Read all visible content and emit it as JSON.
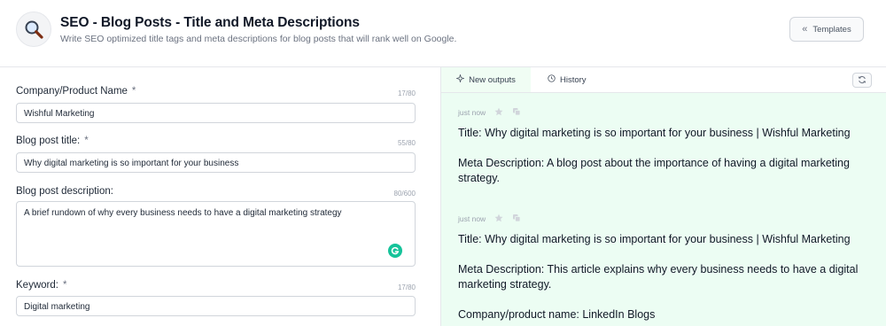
{
  "header": {
    "title": "SEO - Blog Posts - Title and Meta Descriptions",
    "subtitle": "Write SEO optimized title tags and meta descriptions for blog posts that will rank well on Google.",
    "templates_label": "Templates",
    "logo_icon": "magnifying-glass-icon"
  },
  "form": {
    "company": {
      "label": "Company/Product Name",
      "required": "*",
      "counter": "17/80",
      "value": "Wishful Marketing"
    },
    "blog_title": {
      "label": "Blog post title:",
      "required": "*",
      "counter": "55/80",
      "value": "Why digital marketing is so important for your business"
    },
    "blog_description": {
      "label": "Blog post description:",
      "counter": "80/600",
      "value": "A brief rundown of why every business needs to have a digital marketing strategy"
    },
    "keyword": {
      "label": "Keyword:",
      "required": "*",
      "counter": "17/80",
      "value": "Digital marketing"
    }
  },
  "outputs_panel": {
    "tabs": [
      {
        "label": "New outputs",
        "icon": "sparkle-icon"
      },
      {
        "label": "History",
        "icon": "clock-icon"
      }
    ],
    "outputs": [
      {
        "time": "just now",
        "title_line": "Title: Why digital marketing is so important for your business | Wishful Marketing",
        "meta_line": "Meta Description: A blog post about the importance of having a digital marketing strategy."
      },
      {
        "time": "just now",
        "title_line": "Title: Why digital marketing is so important for your business | Wishful Marketing",
        "meta_line": "Meta Description: This article explains why every business needs to have a digital marketing strategy.",
        "extra_line": "Company/product name: LinkedIn Blogs"
      }
    ]
  },
  "colors": {
    "accent_green_bg": "#ecfdf3",
    "grammarly_green": "#15c39a"
  }
}
